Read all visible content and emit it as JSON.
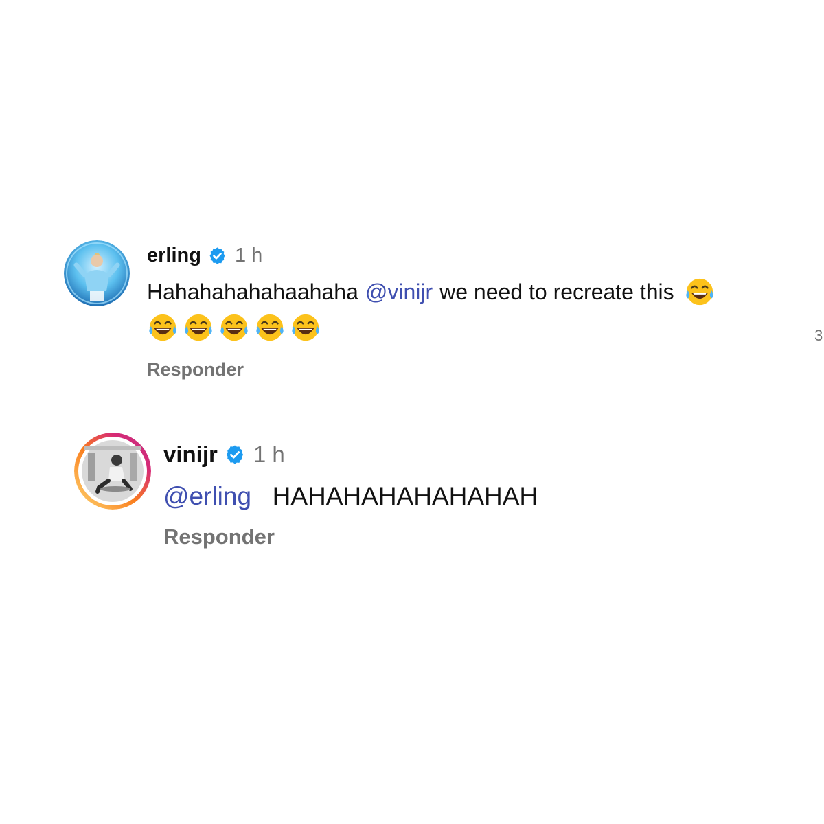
{
  "comments": [
    {
      "username": "erling",
      "verified": true,
      "time": "1 h",
      "text_before": "Hahahahahahaahaha",
      "mention": "@vinijr",
      "text_after": "we need to recreate this",
      "emoji": "face-with-tears-of-joy",
      "reply_label": "Responder",
      "avatar_ring": "none"
    },
    {
      "username": "vinijr",
      "verified": true,
      "time": "1 h",
      "mention": "@erling",
      "text_after": "HAHAHAHAHAHAHAH",
      "reply_label": "Responder",
      "avatar_ring": "instagram-gradient"
    }
  ],
  "edge_count": "3",
  "colors": {
    "verified_badge": "#1d9bf0",
    "mention": "#3f4fb0",
    "meta_text": "#737373",
    "primary_text": "#111111",
    "ring_start": "#feda75",
    "ring_mid": "#fa7e1e",
    "ring_end": "#d62976"
  }
}
